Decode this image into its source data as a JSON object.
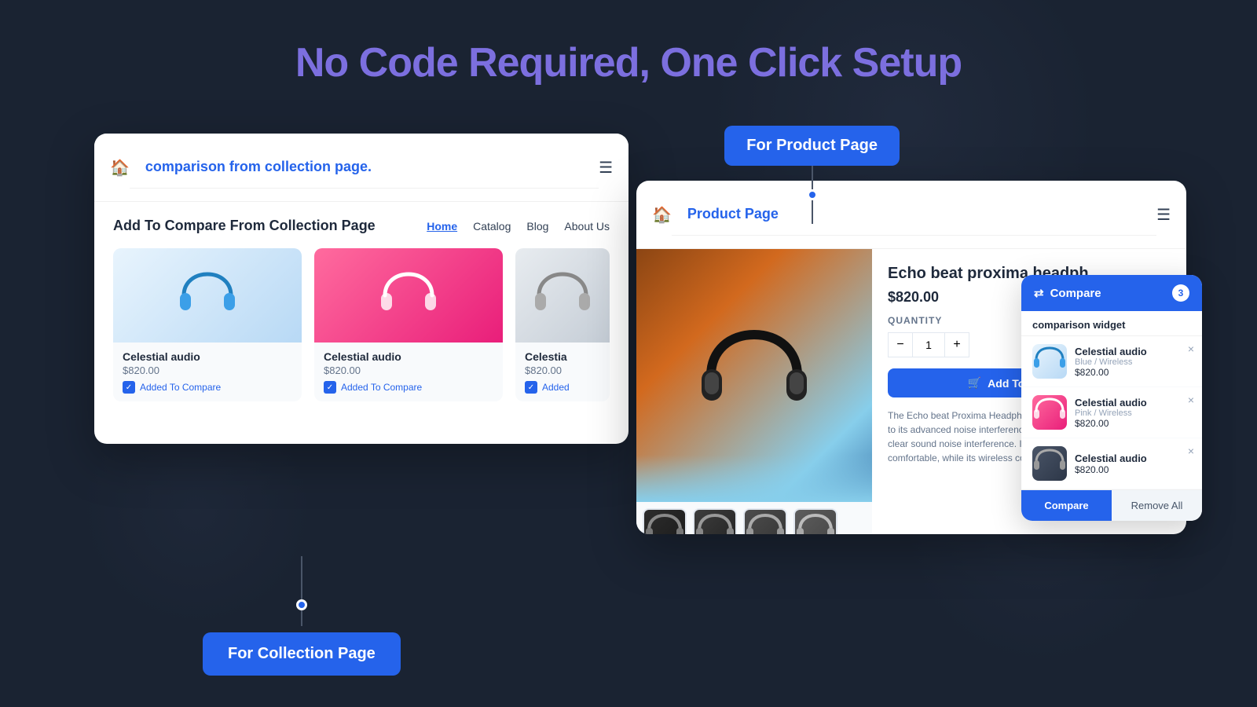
{
  "header": {
    "title_plain": "No Code Required, One ",
    "title_highlight": "Click Setup"
  },
  "collection_card": {
    "navbar_title": "comparison from collection page.",
    "inner_header": "Add To Compare From Collection Page",
    "nav_links": [
      "Home",
      "Catalog",
      "Blog",
      "About Us"
    ],
    "active_nav": "Home",
    "products": [
      {
        "name": "Celestial audio",
        "price": "$820.00",
        "compare_label": "Added To Compare",
        "color": "blue"
      },
      {
        "name": "Celestial audio",
        "price": "$820.00",
        "compare_label": "Added To Compare",
        "color": "pink"
      },
      {
        "name": "Celestia",
        "price": "$820.00",
        "compare_label": "Added",
        "color": "white"
      }
    ]
  },
  "collection_btn": {
    "label": "For Collection Page"
  },
  "product_card": {
    "navbar_title": "Product Page",
    "product_name": "Echo beat proxima headph",
    "price": "$820.00",
    "quantity_label": "QUANTITY",
    "quantity_value": "1",
    "add_to_cart_label": "Add To Cart",
    "description": "The Echo beat Proxima Headphone offers superior design. Thanks to its advanced noise interference technology, you'll experience clear sound noise interference. Its lightweight, adjustable keep you comfortable, while its wireless convenience and easy connectivity.",
    "thumbnails": [
      "thumb-1",
      "thumb-2",
      "thumb-3",
      "thumb-4"
    ]
  },
  "product_btn": {
    "label": "For Product Page"
  },
  "compare_widget": {
    "btn_label": "Compare",
    "count": "3",
    "widget_title": "comparison widget",
    "items": [
      {
        "name": "Celestial audio",
        "variant": "Blue / Wireless",
        "price": "$820.00",
        "color": "blue"
      },
      {
        "name": "Celestial audio",
        "variant": "Pink / Wireless",
        "price": "$820.00",
        "color": "pink"
      },
      {
        "name": "Celestial audio",
        "variant": "",
        "price": "$820.00",
        "color": "dark"
      }
    ],
    "compare_btn": "Compare",
    "remove_btn": "Remove All"
  }
}
